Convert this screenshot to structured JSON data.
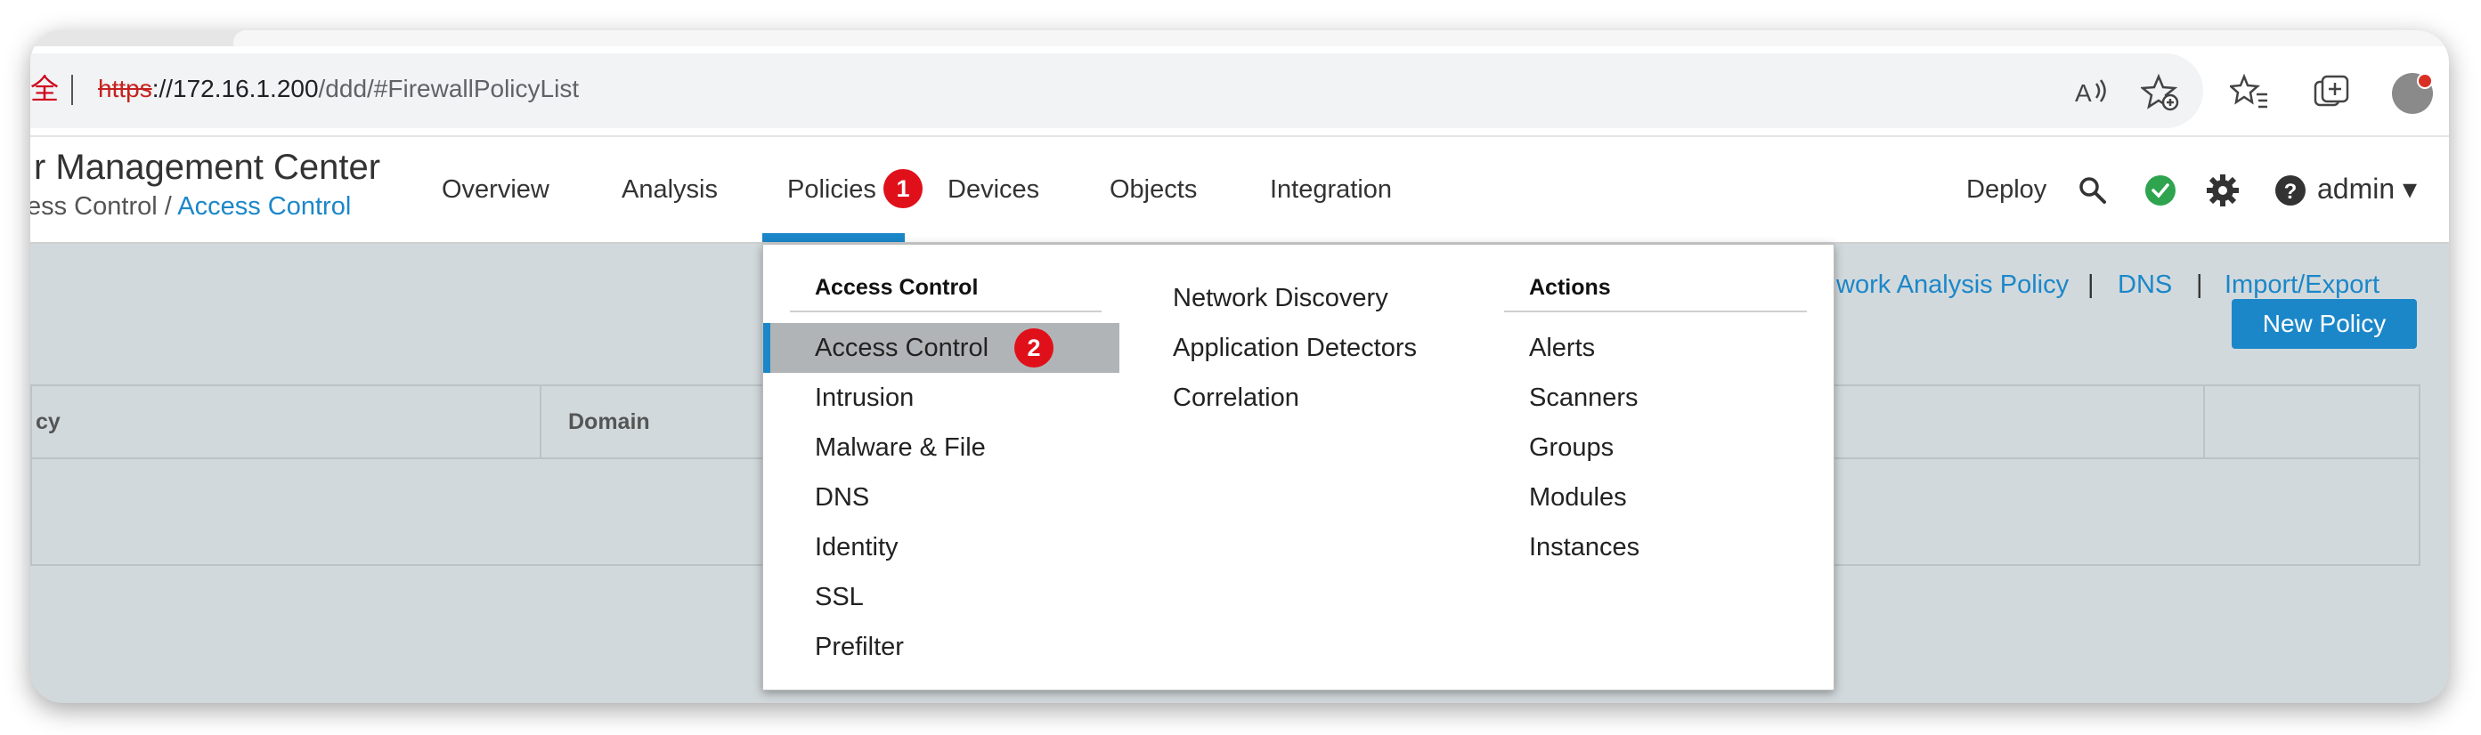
{
  "browser": {
    "security_warning_glyph": "全",
    "url_protocol": "https",
    "url_host": "://172.16.1.200",
    "url_path": "/ddd/#FirewallPolicyList",
    "icons": [
      "read-aloud-icon",
      "favorite-add-icon",
      "favorites-icon",
      "collections-icon",
      "profile-avatar"
    ]
  },
  "header": {
    "app_title": "r Management Center",
    "breadcrumb_prefix": "ess Control / ",
    "breadcrumb_current": "Access Control",
    "nav": {
      "overview": "Overview",
      "analysis": "Analysis",
      "policies": "Policies",
      "devices": "Devices",
      "objects": "Objects",
      "integration": "Integration"
    },
    "deploy": "Deploy",
    "user": "admin ▾",
    "badge_policies": "1"
  },
  "page": {
    "links": {
      "network_analysis_policy": "work Analysis Policy",
      "dns": "DNS",
      "import_export": "Import/Export",
      "separator": "|"
    },
    "new_policy_button": "New Policy",
    "table": {
      "columns": [
        "cy",
        "Domain"
      ]
    }
  },
  "dropdown": {
    "col1_heading": "Access Control",
    "col1_items": [
      "Access Control",
      "Intrusion",
      "Malware & File",
      "DNS",
      "Identity",
      "SSL",
      "Prefilter"
    ],
    "col2_items": [
      "Network Discovery",
      "Application Detectors",
      "Correlation"
    ],
    "col3_heading": "Actions",
    "col3_items": [
      "Alerts",
      "Scanners",
      "Groups",
      "Modules",
      "Instances"
    ],
    "badge_access_control": "2",
    "highlighted_item": "Access Control"
  },
  "colors": {
    "accent": "#1b87c9",
    "badge": "#e0101b",
    "status_ok": "#2ea44f",
    "page_background": "#d2d9dc"
  }
}
